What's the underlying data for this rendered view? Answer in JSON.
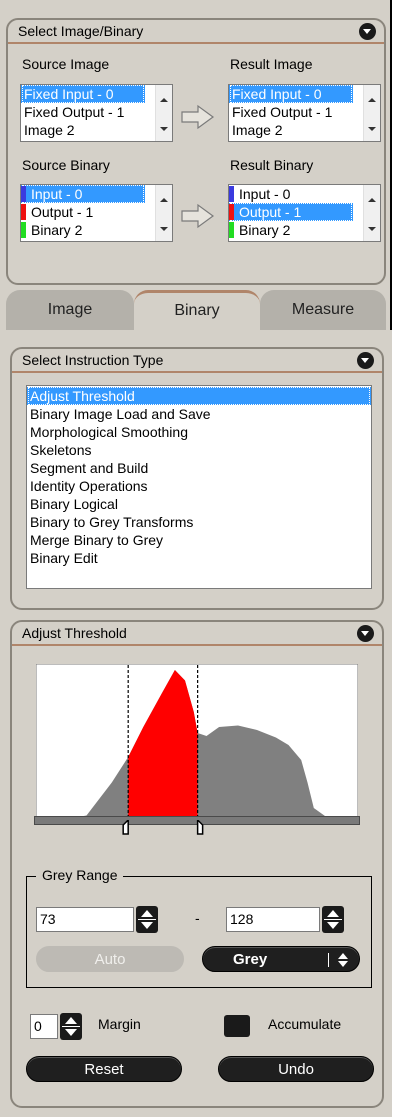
{
  "select_panel": {
    "title": "Select Image/Binary",
    "source_image_label": "Source Image",
    "result_image_label": "Result Image",
    "source_binary_label": "Source Binary",
    "result_binary_label": "Result Binary",
    "source_images": [
      "Fixed Input - 0",
      "Fixed Output - 1",
      "Image 2"
    ],
    "result_images": [
      "Fixed Input - 0",
      "Fixed Output - 1",
      "Image 2"
    ],
    "source_binaries": [
      "Input - 0",
      "Output - 1",
      "Binary 2"
    ],
    "result_binaries": [
      "Input - 0",
      "Output - 1",
      "Binary 2"
    ],
    "binary_colors": [
      "#3a3adf",
      "#ee1111",
      "#22dd22"
    ]
  },
  "tabs": [
    "Image",
    "Binary",
    "Measure"
  ],
  "active_tab": "Binary",
  "instruction_panel": {
    "title": "Select Instruction Type",
    "items": [
      "Adjust Threshold",
      "Binary Image Load and Save",
      "Morphological Smoothing",
      "Skeletons",
      "Segment and Build",
      "Identity Operations",
      "Binary Logical",
      "Binary to Grey Transforms",
      "Merge Binary to Grey",
      "Binary Edit"
    ],
    "selected": "Adjust Threshold"
  },
  "threshold_panel": {
    "title": "Adjust Threshold",
    "grey_range_label": "Grey Range",
    "low_value": "73",
    "high_value": "128",
    "range_separator": "-",
    "auto_label": "Auto",
    "mode_label": "Grey",
    "margin_value": "0",
    "margin_label": "Margin",
    "accumulate_label": "Accumulate",
    "reset_label": "Reset",
    "undo_label": "Undo",
    "histogram_color": "#808080",
    "selection_color": "#ff0000"
  },
  "chart_data": {
    "type": "area",
    "x_range": [
      0,
      255
    ],
    "selected_range": [
      73,
      128
    ],
    "x": [
      0,
      20,
      40,
      60,
      73,
      85,
      100,
      110,
      118,
      125,
      128,
      135,
      145,
      160,
      175,
      190,
      200,
      210,
      215,
      220,
      230,
      240,
      255
    ],
    "values": [
      0,
      0,
      0.03,
      0.25,
      0.42,
      0.62,
      0.85,
      1.0,
      0.93,
      0.72,
      0.58,
      0.56,
      0.62,
      0.63,
      0.6,
      0.55,
      0.5,
      0.4,
      0.25,
      0.08,
      0.02,
      0,
      0
    ]
  }
}
